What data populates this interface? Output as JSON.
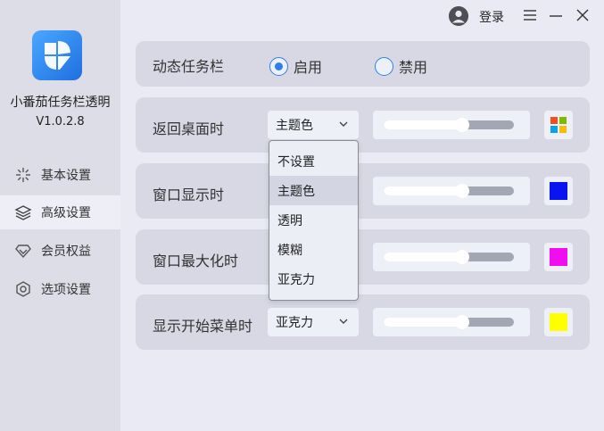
{
  "app": {
    "name": "小番茄任务栏透明",
    "version": "V1.0.2.8"
  },
  "topbar": {
    "login_label": "登录"
  },
  "sidebar": {
    "items": [
      {
        "label": "基本设置",
        "icon": "sparkle-icon",
        "active": false
      },
      {
        "label": "高级设置",
        "icon": "layers-icon",
        "active": true
      },
      {
        "label": "会员权益",
        "icon": "diamond-icon",
        "active": false
      },
      {
        "label": "选项设置",
        "icon": "hexagon-settings-icon",
        "active": false
      }
    ]
  },
  "main": {
    "dynamic_taskbar": {
      "label": "动态任务栏",
      "options": [
        {
          "label": "启用",
          "checked": true
        },
        {
          "label": "禁用",
          "checked": false
        }
      ]
    },
    "rows": [
      {
        "label": "返回桌面时",
        "select_value": "主题色",
        "slider": 0.6,
        "color": "windows-logo"
      },
      {
        "label": "窗口显示时",
        "select_value": "",
        "slider": 0.6,
        "color": "#0a14f0"
      },
      {
        "label": "窗口最大化时",
        "select_value": "",
        "slider": 0.6,
        "color": "#f00ef0"
      },
      {
        "label": "显示开始菜单时",
        "select_value": "亚克力",
        "slider": 0.6,
        "color": "#ffff00"
      }
    ],
    "dropdown": {
      "options": [
        "不设置",
        "主题色",
        "透明",
        "模糊",
        "亚克力"
      ],
      "selected_index": 1
    }
  },
  "colors": {
    "accent": "#2f7fe8",
    "sidebar_bg": "#dcdde7",
    "content_bg": "#e9eaf3",
    "card_bg": "#d7d8e3"
  }
}
